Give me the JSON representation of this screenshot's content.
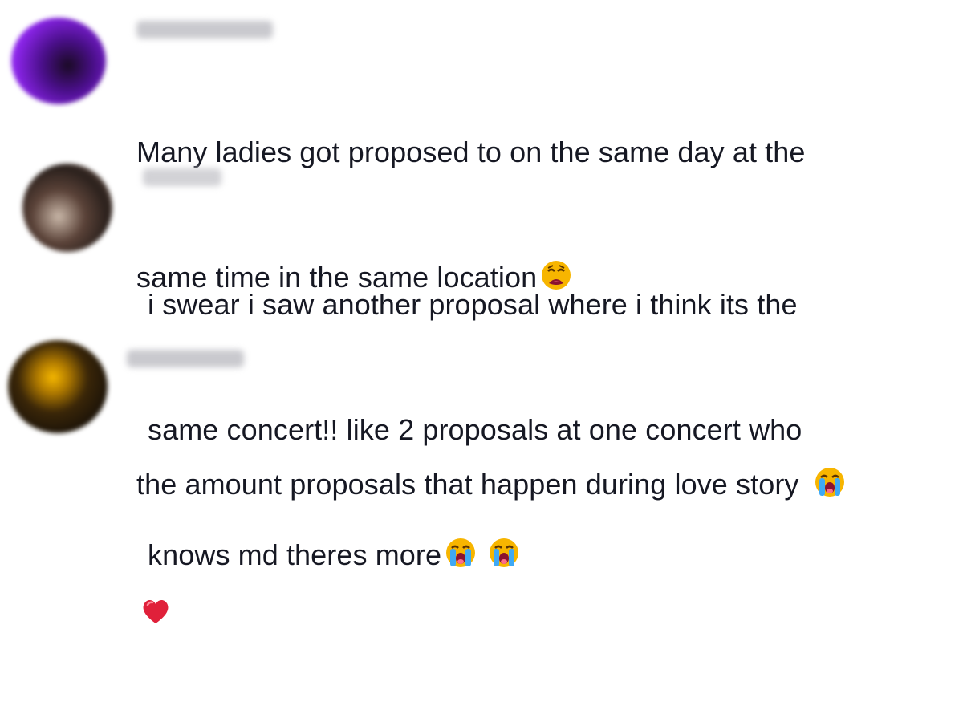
{
  "comments": [
    {
      "username": "",
      "avatar_color": "#7a1bd6",
      "lines": [
        "Many ladies got proposed to on the same day at the",
        "same time in the same location"
      ],
      "emoji": [
        "weary-face"
      ]
    },
    {
      "username": "",
      "avatar_color": "#3a2a26",
      "lines": [
        "i swear i saw another proposal where i think its the",
        "same concert!! like 2 proposals at one concert who",
        "knows md theres more"
      ],
      "emoji": [
        "loudly-crying-face",
        "loudly-crying-face"
      ]
    },
    {
      "username": "",
      "avatar_color": "#2a1f0e",
      "lines": [
        "the amount proposals that happen during love story"
      ],
      "emoji": [
        "loudly-crying-face",
        "red-heart"
      ]
    }
  ],
  "colors": {
    "text": "#161823",
    "username_placeholder": "#c9c9ce",
    "background": "#ffffff"
  }
}
